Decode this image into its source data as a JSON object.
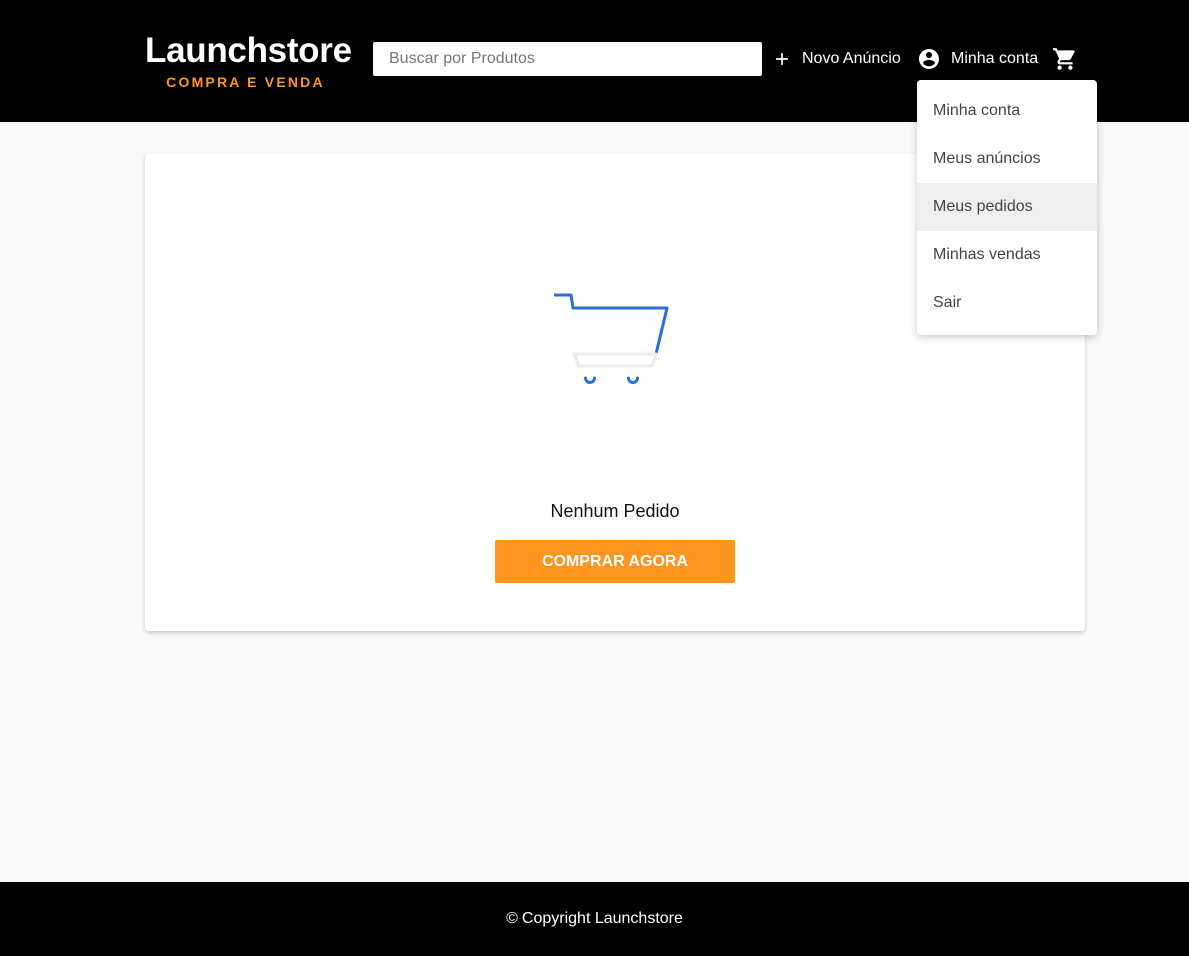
{
  "header": {
    "logo_title": "Launchstore",
    "logo_subtitle": "COMPRA E VENDA",
    "search": {
      "placeholder": "Buscar por Produtos",
      "value": ""
    },
    "new_ad": {
      "label": "Novo Anúncio",
      "icon": "plus-icon"
    },
    "account": {
      "label": "Minha conta",
      "icon": "account-circle-icon"
    },
    "cart": {
      "icon": "shopping-cart-icon"
    }
  },
  "dropdown": {
    "items": [
      {
        "label": "Minha conta"
      },
      {
        "label": "Meus anúncios"
      },
      {
        "label": "Meus pedidos",
        "highlighted": true
      },
      {
        "label": "Minhas vendas"
      },
      {
        "label": "Sair"
      }
    ]
  },
  "main": {
    "empty_icon": "empty-cart-illustration",
    "empty_text": "Nenhum Pedido",
    "cta_label": "Comprar agora"
  },
  "footer": {
    "symbol": "©",
    "text": "Copyright Launchstore"
  },
  "colors": {
    "header_bg": "#000000",
    "accent": "#fd951f",
    "illustration_blue": "#2a6be6",
    "page_bg": "#f8f8f8"
  }
}
